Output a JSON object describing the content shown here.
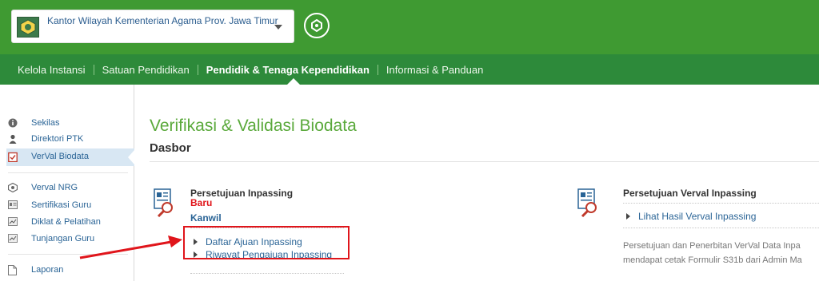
{
  "header": {
    "institution": "Kantor Wilayah Kementerian Agama Prov. Jawa Timur"
  },
  "nav": {
    "items": [
      {
        "label": "Kelola Instansi",
        "active": false
      },
      {
        "label": "Satuan Pendidikan",
        "active": false
      },
      {
        "label": "Pendidik & Tenaga Kependidikan",
        "active": true
      },
      {
        "label": "Informasi & Panduan",
        "active": false
      }
    ]
  },
  "sidebar": {
    "items": [
      {
        "label": "Sekilas",
        "icon": "info-icon"
      },
      {
        "label": "Direktori PTK",
        "icon": "person-icon"
      },
      {
        "label": "VerVal Biodata",
        "icon": "clipboard-check-icon",
        "active": true
      },
      {
        "label": "Verval NRG",
        "icon": "badge-icon"
      },
      {
        "label": "Sertifikasi Guru",
        "icon": "id-card-icon"
      },
      {
        "label": "Diklat & Pelatihan",
        "icon": "chart-icon"
      },
      {
        "label": "Tunjangan Guru",
        "icon": "chart-icon"
      },
      {
        "label": "Laporan",
        "icon": "document-icon"
      }
    ]
  },
  "main": {
    "title": "Verifikasi & Validasi Biodata",
    "subtitle": "Dasbor",
    "card_left": {
      "title": "Persetujuan Inpassing",
      "badge": "Baru",
      "group": "Kanwil",
      "links": [
        "Daftar Ajuan Inpassing",
        "Riwayat Pengajuan Inpassing"
      ]
    },
    "card_right": {
      "title": "Persetujuan Verval Inpassing",
      "links": [
        "Lihat Hasil Verval Inpassing"
      ],
      "description": [
        "Persetujuan dan Penerbitan VerVal Data Inpa",
        "mendapat cetak Formulir S31b dari Admin Ma"
      ]
    }
  },
  "colors": {
    "header_green": "#3f9a32",
    "nav_green": "#2d8a3a",
    "title_green": "#5aa93b",
    "link_blue": "#2a6496",
    "annotation_red": "#e0151b"
  }
}
